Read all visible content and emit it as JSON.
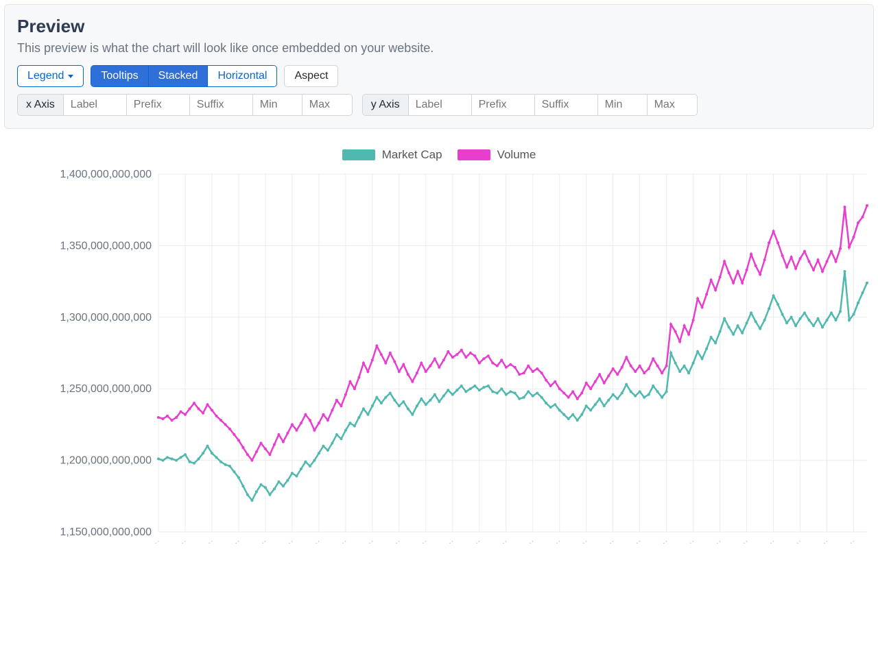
{
  "header": {
    "title": "Preview",
    "subtitle": "This preview is what the chart will look like once embedded on your website."
  },
  "toolbar": {
    "legend_label": "Legend",
    "tooltips_label": "Tooltips",
    "stacked_label": "Stacked",
    "horizontal_label": "Horizontal",
    "aspect_label": "Aspect"
  },
  "axis_controls": {
    "x": {
      "addon": "x Axis",
      "placeholders": {
        "label": "Label",
        "prefix": "Prefix",
        "suffix": "Suffix",
        "min": "Min",
        "max": "Max"
      },
      "values": {
        "label": "",
        "prefix": "",
        "suffix": "",
        "min": "",
        "max": ""
      }
    },
    "y": {
      "addon": "y Axis",
      "placeholders": {
        "label": "Label",
        "prefix": "Prefix",
        "suffix": "Suffix",
        "min": "Min",
        "max": "Max"
      },
      "values": {
        "label": "",
        "prefix": "",
        "suffix": "",
        "min": "",
        "max": ""
      }
    }
  },
  "legend": {
    "items": [
      {
        "name": "Market Cap",
        "color": "#4fb8af"
      },
      {
        "name": "Volume",
        "color": "#e83ecf"
      }
    ]
  },
  "chart_data": {
    "type": "line",
    "ylabel": "",
    "xlabel": "",
    "ylim": [
      1150000000000,
      1400000000000
    ],
    "yticks": [
      1150000000000,
      1200000000000,
      1250000000000,
      1300000000000,
      1350000000000,
      1400000000000
    ],
    "legend_position": "top-center",
    "grid": true,
    "series": [
      {
        "name": "Market Cap",
        "color": "#4fb8af",
        "values": [
          1201,
          1200,
          1202,
          1201,
          1200,
          1202,
          1204,
          1199,
          1198,
          1201,
          1205,
          1210,
          1205,
          1202,
          1199,
          1197,
          1196,
          1192,
          1188,
          1182,
          1176,
          1172,
          1178,
          1183,
          1181,
          1176,
          1180,
          1185,
          1182,
          1186,
          1191,
          1189,
          1194,
          1199,
          1196,
          1200,
          1205,
          1210,
          1207,
          1212,
          1218,
          1215,
          1221,
          1226,
          1224,
          1230,
          1236,
          1232,
          1238,
          1244,
          1240,
          1244,
          1247,
          1242,
          1238,
          1241,
          1236,
          1232,
          1238,
          1243,
          1239,
          1242,
          1246,
          1241,
          1245,
          1249,
          1246,
          1249,
          1252,
          1248,
          1250,
          1252,
          1249,
          1251,
          1252,
          1248,
          1247,
          1250,
          1246,
          1248,
          1247,
          1243,
          1244,
          1248,
          1245,
          1247,
          1244,
          1240,
          1237,
          1239,
          1235,
          1232,
          1229,
          1232,
          1228,
          1232,
          1238,
          1235,
          1239,
          1243,
          1238,
          1242,
          1246,
          1243,
          1247,
          1253,
          1248,
          1245,
          1248,
          1244,
          1246,
          1252,
          1248,
          1244,
          1248,
          1275,
          1268,
          1262,
          1266,
          1261,
          1268,
          1276,
          1271,
          1278,
          1286,
          1282,
          1290,
          1299,
          1293,
          1288,
          1294,
          1289,
          1296,
          1303,
          1297,
          1292,
          1298,
          1306,
          1315,
          1309,
          1302,
          1296,
          1300,
          1294,
          1299,
          1303,
          1298,
          1294,
          1299,
          1293,
          1298,
          1303,
          1298,
          1304,
          1332,
          1298,
          1302,
          1310,
          1317,
          1324
        ],
        "unit_scale": 1000000000
      },
      {
        "name": "Volume",
        "color": "#e83ecf",
        "values": [
          1230,
          1229,
          1231,
          1228,
          1230,
          1234,
          1232,
          1236,
          1240,
          1236,
          1233,
          1239,
          1235,
          1231,
          1228,
          1225,
          1222,
          1218,
          1214,
          1209,
          1204,
          1200,
          1206,
          1212,
          1208,
          1204,
          1211,
          1218,
          1213,
          1219,
          1225,
          1221,
          1226,
          1232,
          1228,
          1221,
          1226,
          1232,
          1228,
          1235,
          1242,
          1238,
          1246,
          1255,
          1250,
          1258,
          1268,
          1262,
          1270,
          1280,
          1274,
          1268,
          1275,
          1269,
          1262,
          1267,
          1260,
          1255,
          1261,
          1268,
          1262,
          1266,
          1271,
          1265,
          1270,
          1276,
          1272,
          1274,
          1277,
          1272,
          1275,
          1273,
          1268,
          1271,
          1273,
          1268,
          1266,
          1270,
          1265,
          1267,
          1265,
          1260,
          1261,
          1266,
          1262,
          1264,
          1261,
          1256,
          1252,
          1255,
          1250,
          1247,
          1244,
          1248,
          1243,
          1247,
          1254,
          1250,
          1255,
          1260,
          1254,
          1259,
          1264,
          1260,
          1265,
          1272,
          1266,
          1262,
          1266,
          1261,
          1264,
          1271,
          1266,
          1261,
          1266,
          1295,
          1290,
          1283,
          1294,
          1288,
          1298,
          1313,
          1307,
          1316,
          1326,
          1319,
          1328,
          1339,
          1331,
          1324,
          1332,
          1324,
          1333,
          1344,
          1336,
          1330,
          1340,
          1352,
          1360,
          1352,
          1343,
          1335,
          1342,
          1334,
          1341,
          1346,
          1339,
          1333,
          1340,
          1332,
          1339,
          1346,
          1339,
          1348,
          1377,
          1349,
          1356,
          1366,
          1370,
          1378
        ],
        "unit_scale": 1000000000
      }
    ]
  }
}
